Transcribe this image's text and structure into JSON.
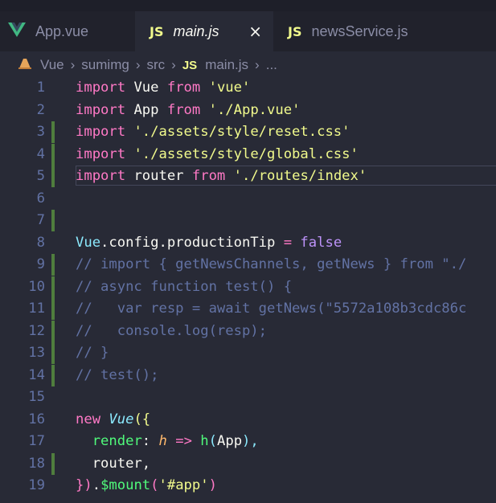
{
  "tabs": [
    {
      "label": "App.vue",
      "icon": "vue-icon",
      "active": false
    },
    {
      "label": "main.js",
      "icon": "js-icon",
      "active": true,
      "close": "×"
    },
    {
      "label": "newsService.js",
      "icon": "js-icon",
      "active": false
    }
  ],
  "icons": {
    "js": "JS",
    "vue": "V"
  },
  "breadcrumb": [
    "Vue",
    "sumimg",
    "src",
    "main.js",
    "..."
  ],
  "colors": {
    "keyword": "#ff79c6",
    "string": "#f1fa8c",
    "comment": "#6272a4",
    "function": "#50fa7b",
    "gutter_modified": "#4f7d3e"
  },
  "line_numbers": [
    "1",
    "2",
    "3",
    "4",
    "5",
    "6",
    "7",
    "8",
    "9",
    "10",
    "11",
    "12",
    "13",
    "14",
    "15",
    "16",
    "17",
    "18",
    "19"
  ],
  "code": {
    "l1": [
      "import",
      " Vue ",
      "from",
      " ",
      "'vue'"
    ],
    "l2": [
      "import",
      " App ",
      "from",
      " ",
      "'./App.vue'"
    ],
    "l3": [
      "import",
      " ",
      "'./assets/style/reset.css'"
    ],
    "l4": [
      "import",
      " ",
      "'./assets/style/global.css'"
    ],
    "l5": [
      "import",
      " router ",
      "from",
      " ",
      "'./routes/index'"
    ],
    "l8": [
      "Vue",
      ".config.productionTip ",
      "=",
      " ",
      "false"
    ],
    "l9": "// import { getNewsChannels, getNews } from \"./",
    "l10": "// async function test() {",
    "l11": "//   var resp = await getNews(\"5572a108b3cdc86c",
    "l12": "//   console.log(resp);",
    "l13": "// }",
    "l14": "// test();",
    "l16": [
      "new",
      " ",
      "Vue",
      "({"
    ],
    "l17": [
      "  ",
      "render",
      ": ",
      "h",
      " ",
      "=>",
      " ",
      "h",
      "(",
      "App",
      "),"
    ],
    "l18": "  router,",
    "l19": [
      "})",
      ".",
      "$mount",
      "(",
      "'#app'",
      ")"
    ]
  }
}
